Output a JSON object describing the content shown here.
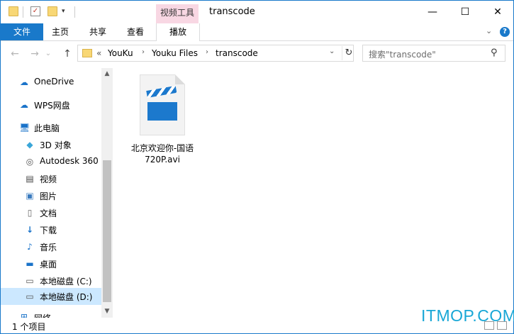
{
  "titlebar": {
    "contextual_tab_label": "视频工具",
    "window_title": "transcode",
    "minimize": "—",
    "maximize": "☐",
    "close": "✕"
  },
  "ribbon": {
    "file_tab": "文件",
    "tabs": [
      "主页",
      "共享",
      "查看"
    ],
    "play_tab": "播放",
    "collapse_icon": "⌄",
    "help_icon": "?"
  },
  "address": {
    "back_icon": "←",
    "forward_icon": "→",
    "recent_icon": "⌄",
    "up_icon": "↑",
    "overflow": "«",
    "breadcrumbs": [
      "YouKu",
      "Youku Files",
      "transcode"
    ],
    "separator": "›",
    "dropdown_icon": "⌄",
    "refresh_icon": "↻"
  },
  "search": {
    "placeholder": "搜索\"transcode\"",
    "icon": "⚲"
  },
  "nav_pane": {
    "items": [
      {
        "label": "OneDrive",
        "icon": "cloud-icon"
      },
      {
        "label": "WPS网盘",
        "icon": "cloud-icon"
      },
      {
        "label": "此电脑",
        "icon": "computer-icon"
      },
      {
        "label": "3D 对象",
        "icon": "cube-icon"
      },
      {
        "label": "Autodesk 360",
        "icon": "autodesk-icon"
      },
      {
        "label": "视频",
        "icon": "video-icon"
      },
      {
        "label": "图片",
        "icon": "picture-icon"
      },
      {
        "label": "文档",
        "icon": "document-icon"
      },
      {
        "label": "下载",
        "icon": "download-icon"
      },
      {
        "label": "音乐",
        "icon": "music-icon"
      },
      {
        "label": "桌面",
        "icon": "desktop-icon"
      },
      {
        "label": "本地磁盘 (C:)",
        "icon": "drive-icon"
      },
      {
        "label": "本地磁盘 (D:)",
        "icon": "drive-icon",
        "selected": true
      },
      {
        "label": "网络",
        "icon": "network-icon"
      }
    ]
  },
  "content": {
    "files": [
      {
        "name_line1": "北京欢迎你-国语",
        "name_line2": "720P.avi",
        "icon": "video-file-icon"
      }
    ]
  },
  "status": {
    "item_count": "1 个项目"
  },
  "watermark": "ITMOP.COM",
  "colors": {
    "accent": "#1979ca",
    "contextual_tab": "#f8d7e3",
    "selection": "#cce8ff",
    "watermark": "#18a7d6"
  }
}
